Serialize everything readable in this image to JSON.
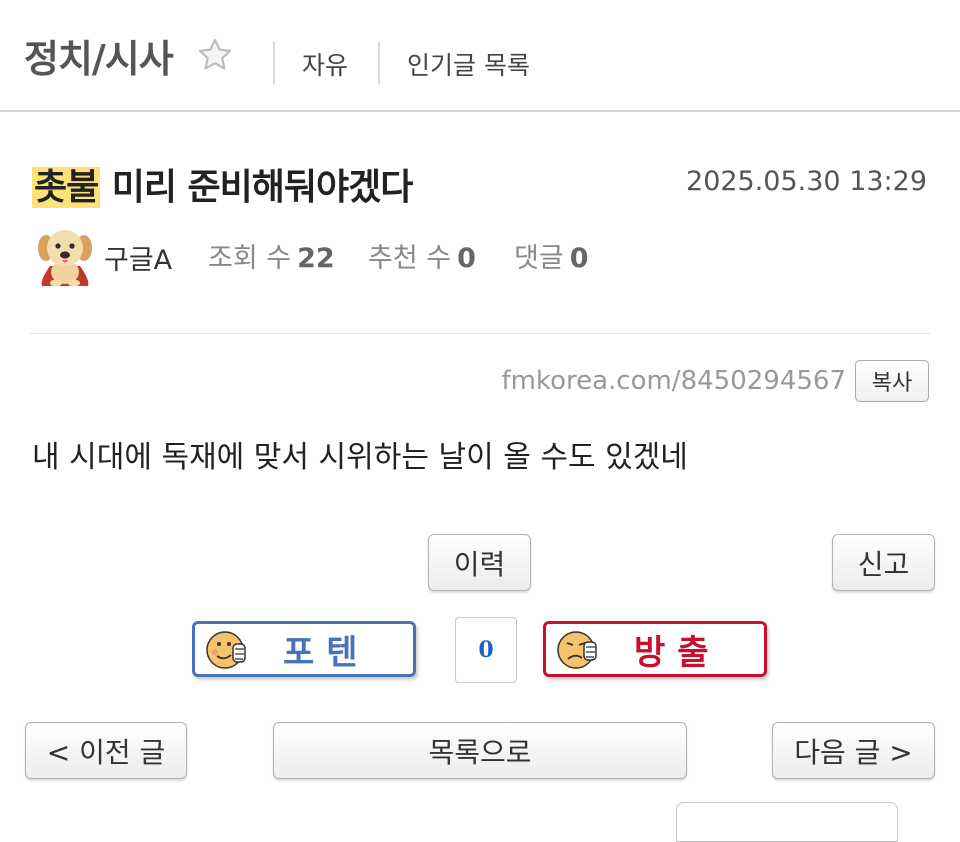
{
  "header": {
    "board_title": "정치/시사",
    "links": [
      "자유",
      "인기글 목록"
    ]
  },
  "post": {
    "title_highlight": "촛불",
    "title_rest": " 미리 준비해둬야겠다",
    "date": "2025.05.30 13:29",
    "author": "구글A",
    "views_label": "조회 수",
    "views": "22",
    "recommends_label": "추천 수",
    "recommends": "0",
    "comments_label": "댓글",
    "comments": "0",
    "url": "fmkorea.com/8450294567",
    "copy_label": "복사",
    "body": "내 시대에 독재에 맞서 시위하는 날이 올 수도 있겠네"
  },
  "actions": {
    "history_label": "이력",
    "report_label": "신고",
    "upvote_label": "포텐",
    "vote_count": "0",
    "downvote_label": "방출",
    "prev_label": "< 이전 글",
    "list_label": "목록으로",
    "next_label": "다음 글 >"
  },
  "colors": {
    "title_highlight": "#fde27a",
    "upvote": "#4a72b8",
    "downvote": "#c8102e",
    "vote_count": "#1f62c4"
  }
}
